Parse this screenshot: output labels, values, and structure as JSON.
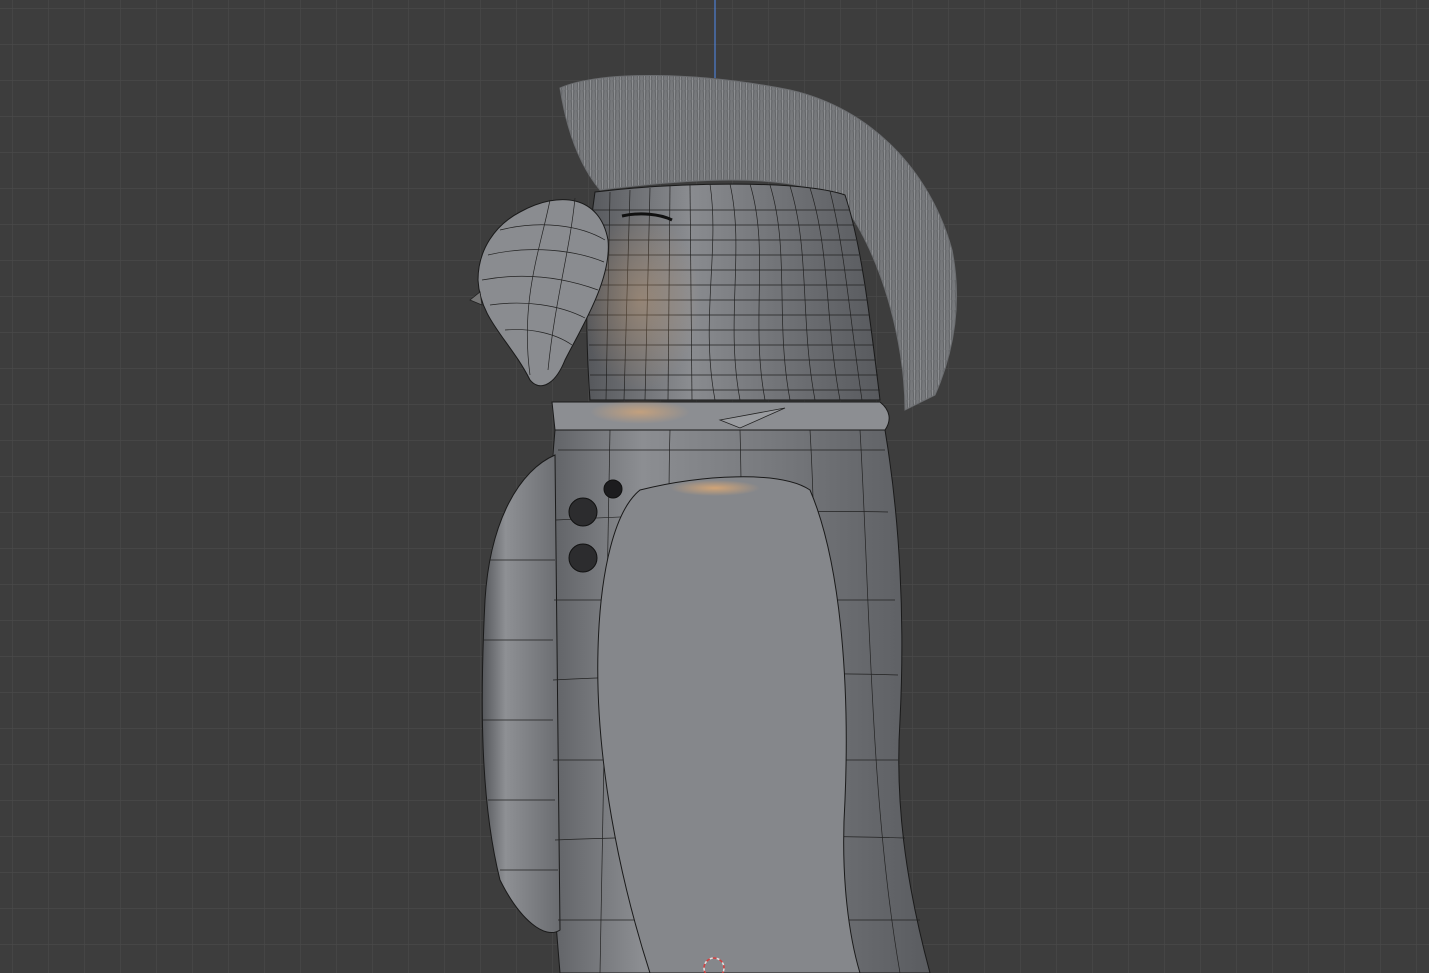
{
  "viewport": {
    "mode": "3d-viewport",
    "background_color": "#3d3d3d",
    "grid_color": "#4a4a4a",
    "axis_z_color": "#4d7fd1",
    "shading": "solid-with-wireframe-overlay"
  },
  "scene": {
    "object": "bird-character-model",
    "parts": [
      "mohawk-hair",
      "beak",
      "head",
      "body",
      "collar",
      "buttons",
      "wing"
    ],
    "mesh_color": "#7a7c80",
    "wire_color": "#1a1a1a",
    "hair_color": "#7f8184",
    "highlight_color": "#d9a36a",
    "cursor_icon": "3d-cursor-icon"
  }
}
